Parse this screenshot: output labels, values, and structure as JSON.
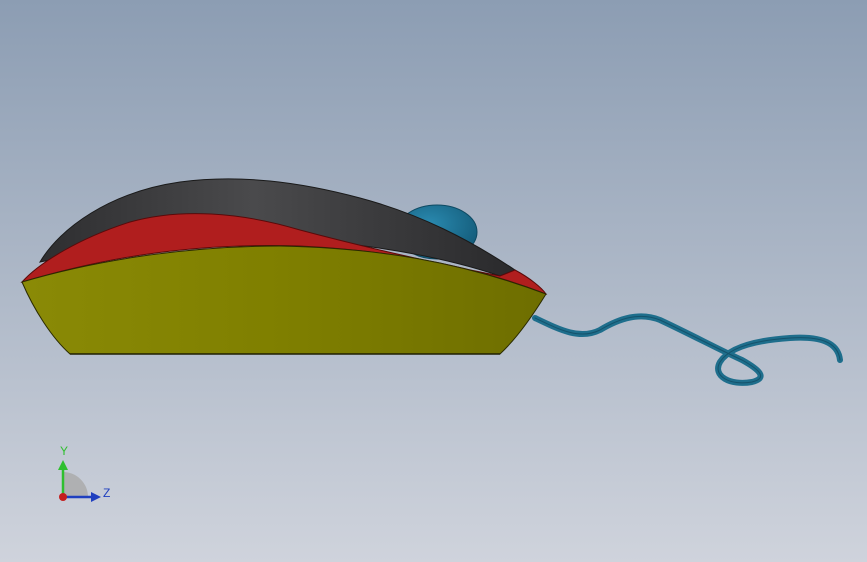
{
  "viewport": {
    "background_top": "#8c9db3",
    "background_bottom": "#cfd3dc"
  },
  "model": {
    "base_color": "#7f7f00",
    "red_band_color": "#b01e1e",
    "shell_color": "#3a3a3c",
    "scroll_wheel_color": "#1a6d8f",
    "cable_color": "#1e6e8c"
  },
  "triad": {
    "y_label": "Y",
    "z_label": "Z",
    "y_color": "#2fbf2f",
    "z_color": "#1f3fbf",
    "x_color": "#c41e1e"
  }
}
